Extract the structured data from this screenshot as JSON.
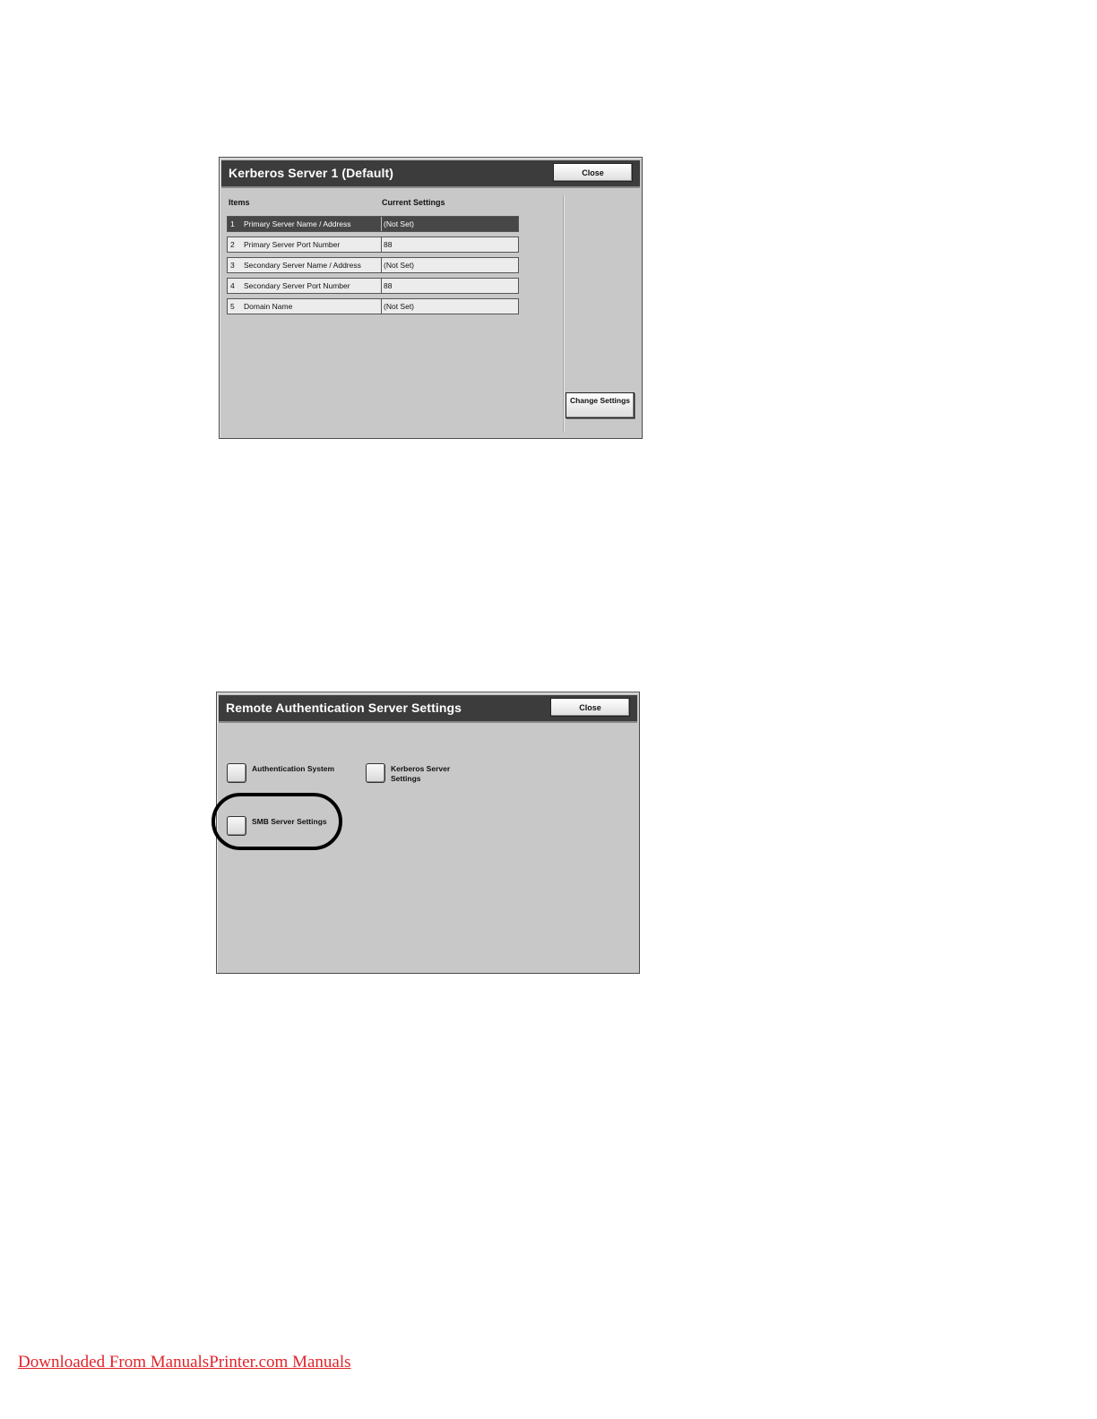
{
  "kerberos_screen": {
    "title": "Kerberos Server 1 (Default)",
    "close_label": "Close",
    "columns": {
      "items": "Items",
      "current_settings": "Current Settings"
    },
    "rows": [
      {
        "num": "1",
        "item": "Primary Server Name / Address",
        "value": "(Not Set)",
        "selected": true
      },
      {
        "num": "2",
        "item": "Primary Server Port Number",
        "value": "88"
      },
      {
        "num": "3",
        "item": "Secondary Server Name / Address",
        "value": "(Not Set)"
      },
      {
        "num": "4",
        "item": "Secondary Server Port Number",
        "value": "88"
      },
      {
        "num": "5",
        "item": "Domain Name",
        "value": "(Not Set)"
      }
    ],
    "change_settings_label": "Change Settings"
  },
  "remote_screen": {
    "title": "Remote Authentication Server Settings",
    "close_label": "Close",
    "options": {
      "authentication_system": "Authentication System",
      "kerberos_line1": "Kerberos Server",
      "kerberos_line2": "Settings",
      "smb": "SMB Server Settings"
    }
  },
  "footer": {
    "link_text": "Downloaded From ManualsPrinter.com Manuals"
  },
  "colors": {
    "titlebar": "#3c3c3c",
    "panel": "#c8c8c8",
    "selected_row": "#474747",
    "footer_link": "#e0242b"
  }
}
